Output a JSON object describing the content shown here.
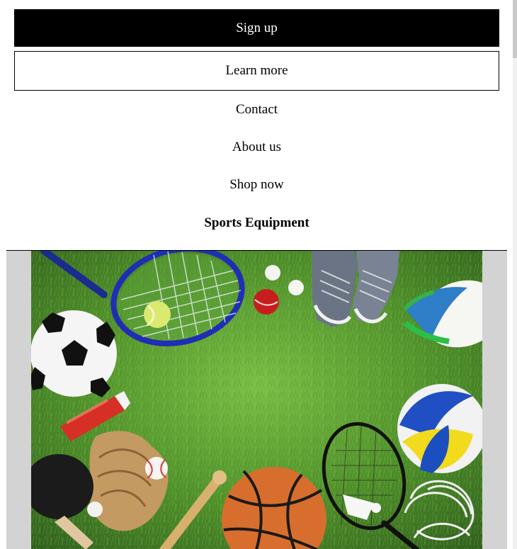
{
  "actions": {
    "signup_label": "Sign up",
    "learn_more_label": "Learn more"
  },
  "links": {
    "contact": "Contact",
    "about": "About us",
    "shop": "Shop now"
  },
  "section": {
    "title": "Sports Equipment"
  },
  "colors": {
    "primary_button_bg": "#000000",
    "primary_button_text": "#ffffff",
    "outline_border": "#000000",
    "image_frame_bg": "#d3d3d3"
  }
}
